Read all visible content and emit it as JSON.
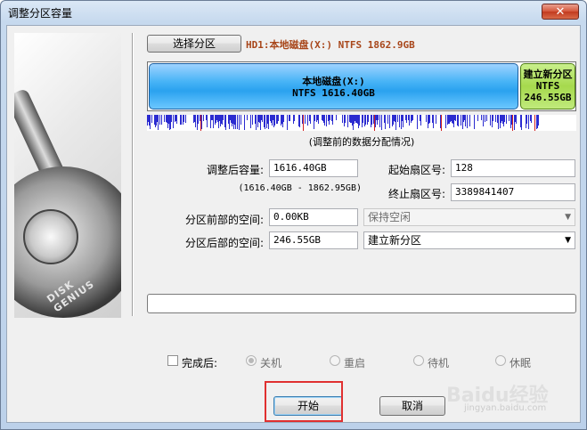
{
  "window": {
    "title": "调整分区容量",
    "close_label": "✕"
  },
  "toolbar": {
    "select_partition_label": "选择分区",
    "partition_info": "HD1:本地磁盘(X:) NTFS 1862.9GB"
  },
  "partition_map": {
    "main": {
      "name": "本地磁盘(X:)",
      "fs_size": "NTFS 1616.40GB",
      "color": "#2aa2ef"
    },
    "new": {
      "name": "建立新分区",
      "fs": "NTFS",
      "size": "246.55GB",
      "color": "#a6d94d"
    }
  },
  "data_strip": {
    "caption": "(调整前的数据分配情况)",
    "used_color": "#2b2bd0",
    "marker_color": "#d02020"
  },
  "form": {
    "new_size_label": "调整后容量:",
    "new_size_value": "1616.40GB",
    "size_range": "(1616.40GB - 1862.95GB)",
    "start_sector_label": "起始扇区号:",
    "start_sector_value": "128",
    "end_sector_label": "终止扇区号:",
    "end_sector_value": "3389841407",
    "space_before_label": "分区前部的空间:",
    "space_before_value": "0.00KB",
    "space_before_option": "保持空闲",
    "space_after_label": "分区后部的空间:",
    "space_after_value": "246.55GB",
    "space_after_option": "建立新分区"
  },
  "after_done": {
    "label": "完成后:",
    "options": [
      "关机",
      "重启",
      "待机",
      "休眠"
    ]
  },
  "buttons": {
    "start": "开始",
    "cancel": "取消"
  },
  "logo": {
    "disk_genius": "DISK GENIUS"
  },
  "watermark": {
    "text": "Baidu经验",
    "sub": "jingyan.baidu.com"
  },
  "colors": {
    "highlight": "#e03030",
    "title_bar": "#c6d9ee"
  }
}
